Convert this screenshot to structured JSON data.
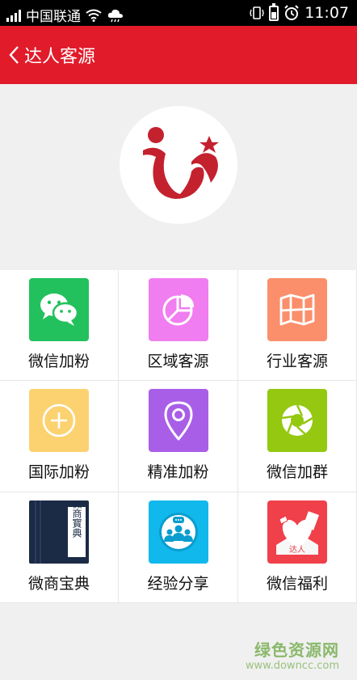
{
  "status_bar": {
    "carrier": "中国联通",
    "time": "11:07"
  },
  "header": {
    "title": "达人客源"
  },
  "grid": [
    {
      "label": "微信加粉",
      "icon": "wechat-icon",
      "color": "#22c15d"
    },
    {
      "label": "区域客源",
      "icon": "pie-chart-icon",
      "color": "#f07ef0"
    },
    {
      "label": "行业客源",
      "icon": "map-icon",
      "color": "#fb8f6c"
    },
    {
      "label": "国际加粉",
      "icon": "plus-circle-icon",
      "color": "#fcd271"
    },
    {
      "label": "精准加粉",
      "icon": "location-pin-icon",
      "color": "#a95ee8"
    },
    {
      "label": "微信加群",
      "icon": "camera-shutter-icon",
      "color": "#94c811"
    },
    {
      "label": "微商宝典",
      "icon": "book-icon",
      "color": "#1b2a45",
      "icon_text": "微商寳典"
    },
    {
      "label": "经验分享",
      "icon": "group-chat-icon",
      "color": "#11b8ec"
    },
    {
      "label": "微信福利",
      "icon": "heart-gift-icon",
      "color": "#f0404a",
      "icon_text": "达人"
    }
  ],
  "watermark": {
    "text": "绿色资源网",
    "url": "www.downcc.com"
  }
}
